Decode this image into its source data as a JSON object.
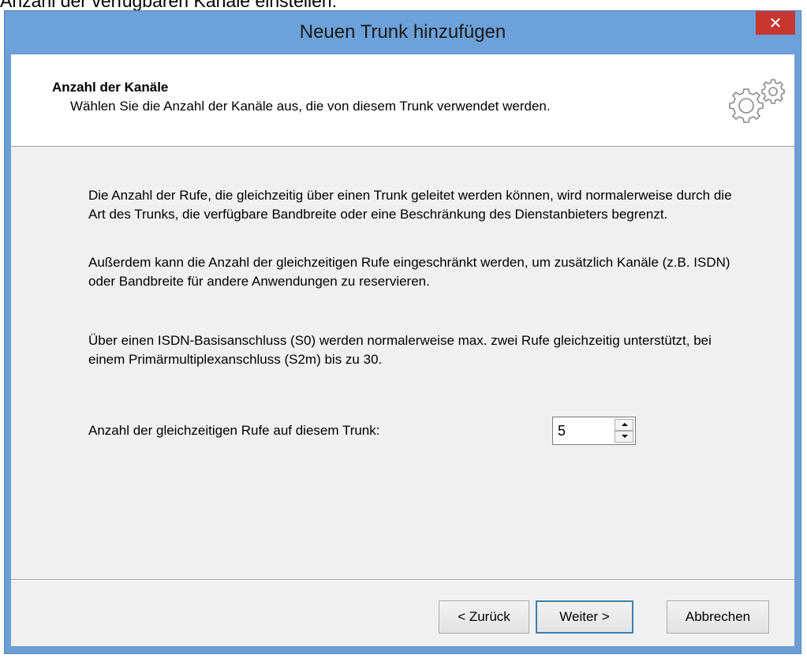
{
  "page_caption": "Anzahl der verfügbaren Kanäle einstellen.",
  "window": {
    "title": "Neuen Trunk hinzufügen",
    "close_label": "✕"
  },
  "header": {
    "title": "Anzahl der Kanäle",
    "subtitle": "Wählen Sie die Anzahl der Kanäle aus, die von diesem Trunk verwendet werden.",
    "icon": "gears-icon"
  },
  "body": {
    "paragraph1": "Die Anzahl der Rufe, die gleichzeitig über einen Trunk geleitet werden können, wird normalerweise durch die  Art des Trunks, die verfügbare Bandbreite oder eine Beschränkung des Dienstanbieters begrenzt.",
    "paragraph2": "Außerdem kann die Anzahl der gleichzeitigen Rufe eingeschränkt werden, um zusätzlich Kanäle (z.B. ISDN) oder Bandbreite für andere Anwendungen zu reservieren.",
    "paragraph3": "Über einen ISDN-Basisanschluss (S0) werden normalerweise max. zwei Rufe gleichzeitig unterstützt, bei einem Primärmultiplexanschluss (S2m) bis zu 30."
  },
  "field": {
    "label": "Anzahl der gleichzeitigen Rufe auf diesem Trunk:",
    "value": "5"
  },
  "buttons": {
    "back": "< Zurück",
    "next": "Weiter >",
    "cancel": "Abbrechen"
  },
  "colors": {
    "titlebar": "#6da1d9",
    "close": "#c7372f",
    "dialog_bg": "#f0f0f0"
  }
}
